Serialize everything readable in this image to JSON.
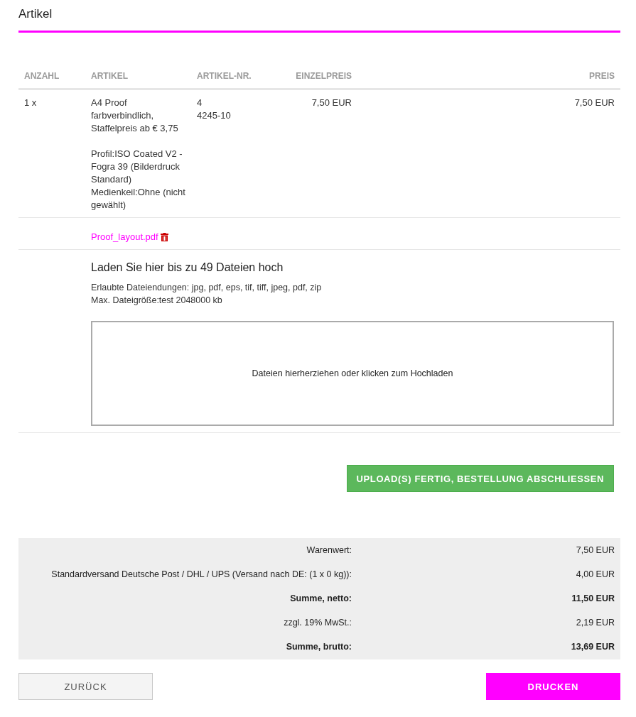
{
  "section": {
    "title": "Artikel"
  },
  "table": {
    "columns": [
      "ANZAHL",
      "ARTIKEL",
      "ARTIKEL-NR.",
      "EINZELPREIS",
      "PREIS"
    ],
    "rows": [
      {
        "quantity": "1 x",
        "article": {
          "name": "A4 Proof farbverbindlich, Staffelpreis ab € 3,75",
          "options": [
            "Profil:ISO Coated V2 - Fogra 39 (Bilderdruck Standard)",
            "Medienkeil:Ohne (nicht gewählt)"
          ]
        },
        "article_numbers": [
          "4",
          "4245-10"
        ],
        "unit_price": "7,50 EUR",
        "price": "7,50 EUR"
      }
    ]
  },
  "attachments": [
    {
      "name": "Proof_layout.pdf"
    }
  ],
  "upload": {
    "heading": "Laden Sie hier bis zu 49 Dateien hoch",
    "allowed_types": "Erlaubte Dateiendungen: jpg, pdf, eps, tif, tiff, jpeg, pdf, zip",
    "max_size": "Max. Dateigröße:test 2048000 kb",
    "dropzone": "Dateien hierherziehen oder klicken zum Hochladen"
  },
  "finish_button": "UPLOAD(S) FERTIG, BESTELLUNG ABSCHLIESSEN",
  "totals": [
    {
      "label": "Warenwert:",
      "value": "7,50 EUR",
      "emphasis": false
    },
    {
      "label": "Standardversand Deutsche Post / DHL / UPS (Versand nach DE: (1 x 0 kg)):",
      "value": "4,00 EUR",
      "emphasis": false
    },
    {
      "label": "Summe, netto:",
      "value": "11,50 EUR",
      "emphasis": true
    },
    {
      "label": "zzgl. 19% MwSt.:",
      "value": "2,19 EUR",
      "emphasis": false
    },
    {
      "label": "Summe, brutto:",
      "value": "13,69 EUR",
      "emphasis": true
    }
  ],
  "buttons": {
    "back": "ZURÜCK",
    "print": "DRUCKEN"
  }
}
